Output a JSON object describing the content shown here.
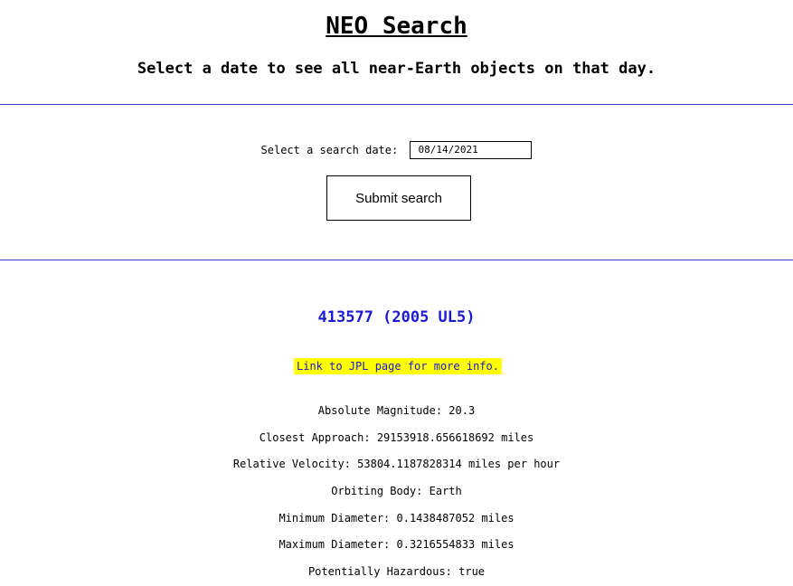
{
  "header": {
    "title": "NEO Search",
    "subtitle": "Select a date to see all near-Earth objects on that day."
  },
  "search": {
    "label": "Select a search date:",
    "date_value": "08/14/2021",
    "submit_label": "Submit search"
  },
  "result": {
    "name": "413577 (2005 UL5)",
    "jpl_link_text": "Link to JPL page for more info.",
    "details": [
      "Absolute Magnitude: 20.3",
      "Closest Approach: 29153918.656618692 miles",
      "Relative Velocity: 53804.1187828314 miles per hour",
      "Orbiting Body: Earth",
      "Minimum Diameter: 0.1438487052 miles",
      "Maximum Diameter: 0.3216554833 miles",
      "Potentially Hazardous: true"
    ]
  },
  "colors": {
    "rule": "#3b3bd4",
    "link_text": "#1a1ad6",
    "highlight": "#ffff00"
  }
}
